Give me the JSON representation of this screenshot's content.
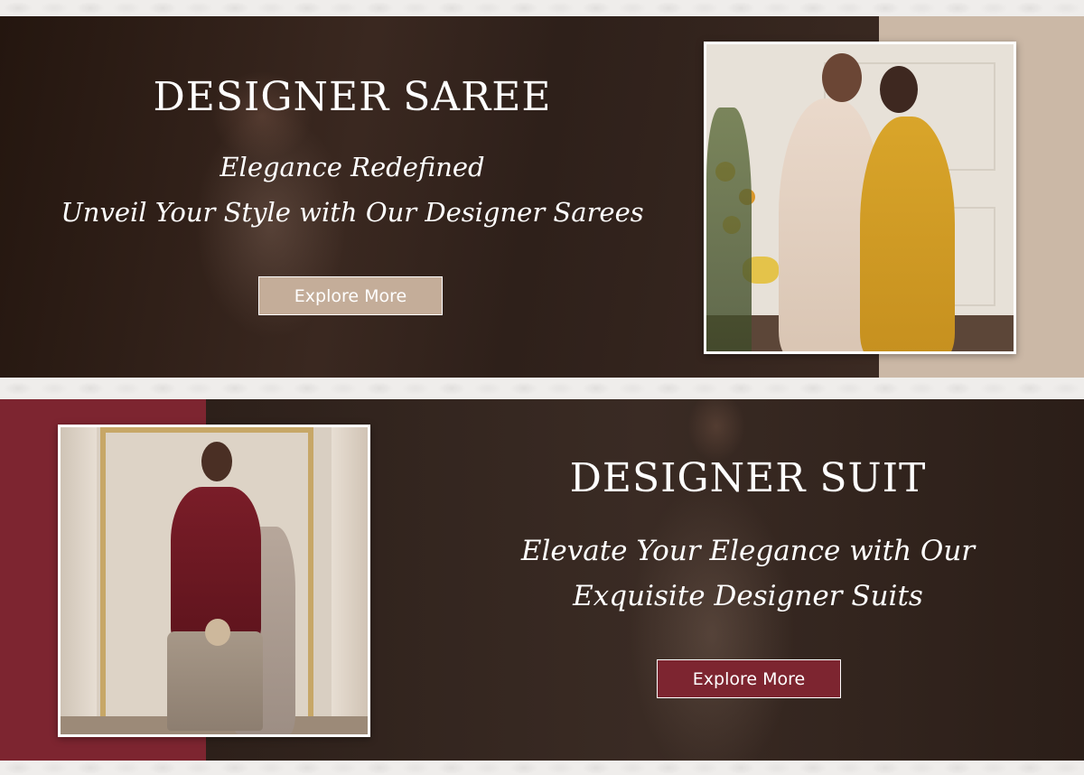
{
  "banners": [
    {
      "headline": "DESIGNER SAREE",
      "tagline_lines": [
        "Elegance Redefined",
        "Unveil Your Style with Our Designer Sarees"
      ],
      "cta_label": "Explore More",
      "colors": {
        "background": "#2b1d18",
        "side_panel": "#cbb8a6",
        "button": "#c4ad99"
      }
    },
    {
      "headline": "DESIGNER SUIT",
      "tagline_lines": [
        "Elevate Your Elegance with Our",
        "Exquisite Designer Suits"
      ],
      "cta_label": "Explore More",
      "colors": {
        "background": "#2a1e19",
        "side_panel": "#7d2530",
        "button": "#7d2530"
      }
    }
  ]
}
